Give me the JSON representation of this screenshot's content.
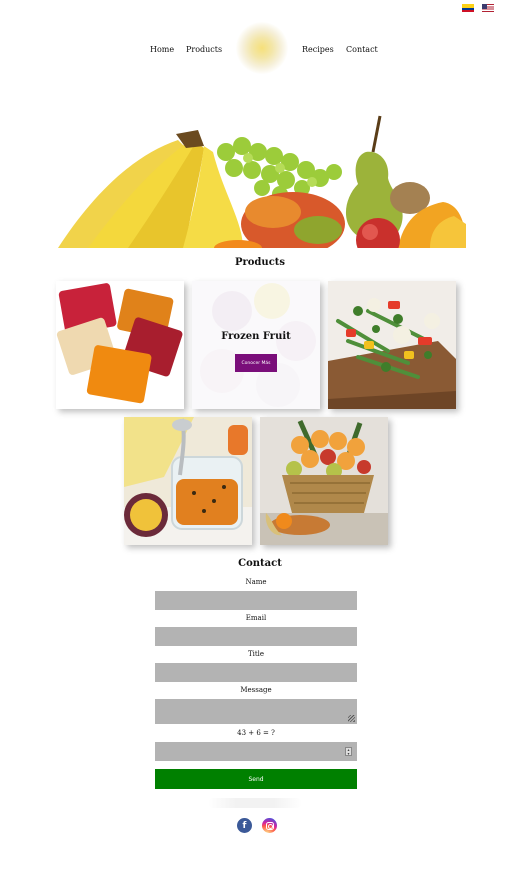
{
  "language_flags": [
    {
      "name": "colombia-flag"
    },
    {
      "name": "us-flag"
    }
  ],
  "nav": {
    "home": "Home",
    "products": "Products",
    "recipes": "Recipes",
    "contact": "Contact"
  },
  "products": {
    "title": "Products",
    "tiles": [
      {
        "image": "fruit pulp packets"
      },
      {
        "image": "frozen fruit",
        "overlay_title": "Frozen Fruit",
        "overlay_button": "Conocer Más"
      },
      {
        "image": "frozen vegetables on board"
      },
      {
        "image": "passion fruit jam jar"
      },
      {
        "image": "fruit gift basket"
      }
    ]
  },
  "contact": {
    "title": "Contact",
    "name_label": "Name",
    "email_label": "Email",
    "title_label": "Title",
    "message_label": "Message",
    "captcha_label": "43 + 6 = ?",
    "send_label": "Send"
  },
  "social": [
    {
      "name": "facebook-icon",
      "glyph": "f",
      "color": "#3b5998"
    },
    {
      "name": "instagram-icon"
    }
  ],
  "colors": {
    "send_button": "#008000",
    "overlay_button": "#7a0e7a",
    "input_background": "#b3b3b3"
  }
}
